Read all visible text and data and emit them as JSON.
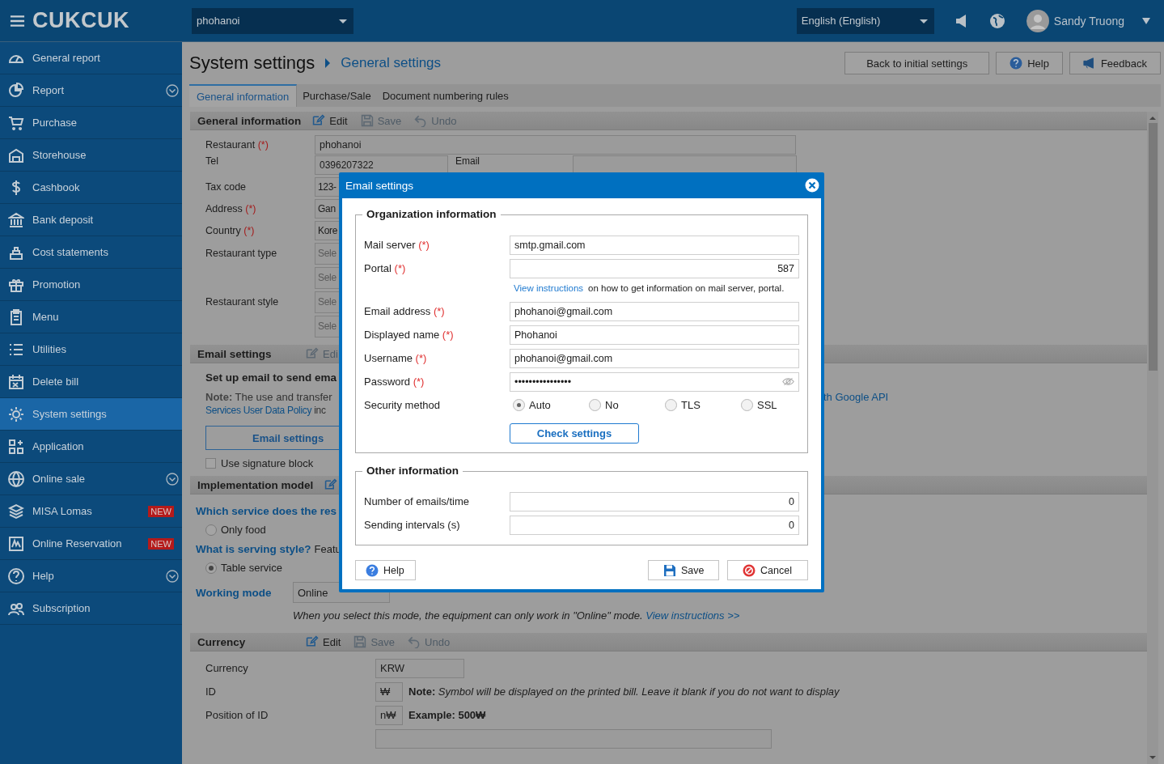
{
  "header": {
    "logo": "CUKCUK",
    "restaurant_select": "phohanoi",
    "language_select": "English (English)",
    "user": "Sandy Truong"
  },
  "sidebar": {
    "items": [
      {
        "label": "General report",
        "selected": false,
        "expandable": false
      },
      {
        "label": "Report",
        "selected": false,
        "expandable": true
      },
      {
        "label": "Purchase",
        "selected": false,
        "expandable": false
      },
      {
        "label": "Storehouse",
        "selected": false,
        "expandable": false
      },
      {
        "label": "Cashbook",
        "selected": false,
        "expandable": false
      },
      {
        "label": "Bank deposit",
        "selected": false,
        "expandable": false
      },
      {
        "label": "Cost statements",
        "selected": false,
        "expandable": false
      },
      {
        "label": "Promotion",
        "selected": false,
        "expandable": false
      },
      {
        "label": "Menu",
        "selected": false,
        "expandable": false
      },
      {
        "label": "Utilities",
        "selected": false,
        "expandable": false
      },
      {
        "label": "Delete bill",
        "selected": false,
        "expandable": false
      },
      {
        "label": "System settings",
        "selected": true,
        "expandable": false
      },
      {
        "label": "Application",
        "selected": false,
        "expandable": false
      },
      {
        "label": "Online sale",
        "selected": false,
        "expandable": true
      },
      {
        "label": "MISA Lomas",
        "selected": false,
        "expandable": false,
        "badge": "NEW"
      },
      {
        "label": "Online Reservation",
        "selected": false,
        "expandable": false,
        "badge": "NEW"
      },
      {
        "label": "Help",
        "selected": false,
        "expandable": true
      },
      {
        "label": "Subscription",
        "selected": false,
        "expandable": false
      }
    ]
  },
  "page": {
    "title": "System settings",
    "breadcrumb": "General settings",
    "buttons": [
      {
        "label": "Back to initial settings",
        "kind": "plain"
      },
      {
        "label": "Help",
        "kind": "help"
      },
      {
        "label": "Feedback",
        "kind": "feedback"
      }
    ]
  },
  "tabs": [
    {
      "label": "General information",
      "selected": true
    },
    {
      "label": "Purchase/Sale",
      "selected": false
    },
    {
      "label": "Document numbering rules",
      "selected": false
    }
  ],
  "general_information": {
    "title": "General information",
    "actions": [
      {
        "kind": "edit",
        "label": "Edit",
        "disabled": false
      },
      {
        "kind": "save",
        "label": "Save",
        "disabled": true
      },
      {
        "kind": "undo",
        "label": "Undo",
        "disabled": true
      }
    ],
    "rows": [
      {
        "kind": "wide",
        "label": "Restaurant",
        "required_mark": "(*)",
        "value": "phohanoi"
      },
      {
        "kind": "pair",
        "label": "Tel",
        "value": "0396207322",
        "label_2": "Email"
      },
      {
        "kind": "cut",
        "label": "Tax code",
        "value": "123-"
      },
      {
        "kind": "cut",
        "label": "Address",
        "required_mark": "(*)",
        "value": "Gan"
      },
      {
        "kind": "cut",
        "label": "Country",
        "required_mark": "(*)",
        "value": "Kore"
      },
      {
        "kind": "select",
        "label": "Restaurant type",
        "placeholder": "Sele"
      },
      {
        "kind": "select",
        "placeholder": "Sele"
      },
      {
        "kind": "select",
        "label": "Restaurant style",
        "placeholder": "Sele"
      },
      {
        "kind": "select",
        "placeholder": "Sele"
      }
    ]
  },
  "email_settings": {
    "title": "Email settings",
    "actions": [
      {
        "kind": "edit",
        "label": "Edi",
        "disabled": true
      }
    ],
    "heading": "Set up email to send ema",
    "note_label": "Note:",
    "note_text": "The use and transfer",
    "note_link": "Services User Data Policy",
    "note_text_2": "inc",
    "right_link": "th Google API",
    "button": "Email settings",
    "signature": {
      "label": "Use signature block",
      "checked": false
    }
  },
  "implementation_model": {
    "title": "Implementation model",
    "actions": [
      {
        "kind": "edit",
        "disabled": false
      }
    ],
    "questions": [
      {
        "question": "Which service does the res",
        "options": [
          {
            "label": "Only food",
            "selected": false
          }
        ]
      },
      {
        "question": "What is serving style?",
        "hint": "Featu",
        "options": [
          {
            "label": "Table service",
            "selected": true
          }
        ]
      }
    ],
    "working_mode": {
      "label": "Working mode",
      "value": "Online",
      "note": "When you select this mode, the equipment can only work in \"Online\" mode.",
      "link": "View instructions >>"
    }
  },
  "currency": {
    "title": "Currency",
    "actions": [
      {
        "kind": "edit",
        "label": "Edit",
        "disabled": false
      },
      {
        "kind": "save",
        "label": "Save",
        "disabled": true
      },
      {
        "kind": "undo",
        "label": "Undo",
        "disabled": true
      }
    ],
    "rows": [
      {
        "label": "Currency",
        "value": "KRW"
      },
      {
        "label": "ID",
        "value": "₩",
        "note_label": "Note:",
        "note": "Symbol will be displayed on the printed bill. Leave it blank if you do not want to display"
      },
      {
        "label": "Position of ID",
        "value": "n₩",
        "example": "Example: 500₩"
      }
    ]
  },
  "dialog": {
    "title": "Email settings",
    "groups": [
      {
        "title": "Organization information",
        "fields": [
          {
            "kind": "text",
            "label": "Mail server",
            "required_mark": "(*)",
            "value": "smtp.gmail.com"
          },
          {
            "kind": "number",
            "label": "Portal",
            "required_mark": "(*)",
            "value": "587"
          },
          {
            "kind": "hint",
            "link": "View instructions",
            "text": "on how to get information on mail server, portal."
          },
          {
            "kind": "text",
            "label": "Email address",
            "required_mark": "(*)",
            "value": "phohanoi@gmail.com"
          },
          {
            "kind": "text",
            "label": "Displayed name",
            "required_mark": "(*)",
            "value": "Phohanoi"
          },
          {
            "kind": "text",
            "label": "Username",
            "required_mark": "(*)",
            "value": "phohanoi@gmail.com"
          },
          {
            "kind": "password",
            "label": "Password",
            "required_mark": "(*)",
            "value": "••••••••••••••••"
          },
          {
            "kind": "radio",
            "label": "Security method",
            "options": [
              {
                "label": "Auto",
                "selected": true
              },
              {
                "label": "No",
                "selected": false
              },
              {
                "label": "TLS",
                "selected": false
              },
              {
                "label": "SSL",
                "selected": false
              }
            ]
          },
          {
            "kind": "button",
            "label": "Check settings"
          }
        ]
      },
      {
        "title": "Other information",
        "fields": [
          {
            "kind": "number",
            "label": "Number of emails/time",
            "value": "0"
          },
          {
            "kind": "number",
            "label": "Sending intervals (s)",
            "value": "0"
          }
        ]
      }
    ],
    "buttons": [
      {
        "kind": "help",
        "label": "Help"
      },
      {
        "kind": "save",
        "label": "Save"
      },
      {
        "kind": "cancel",
        "label": "Cancel"
      }
    ]
  }
}
